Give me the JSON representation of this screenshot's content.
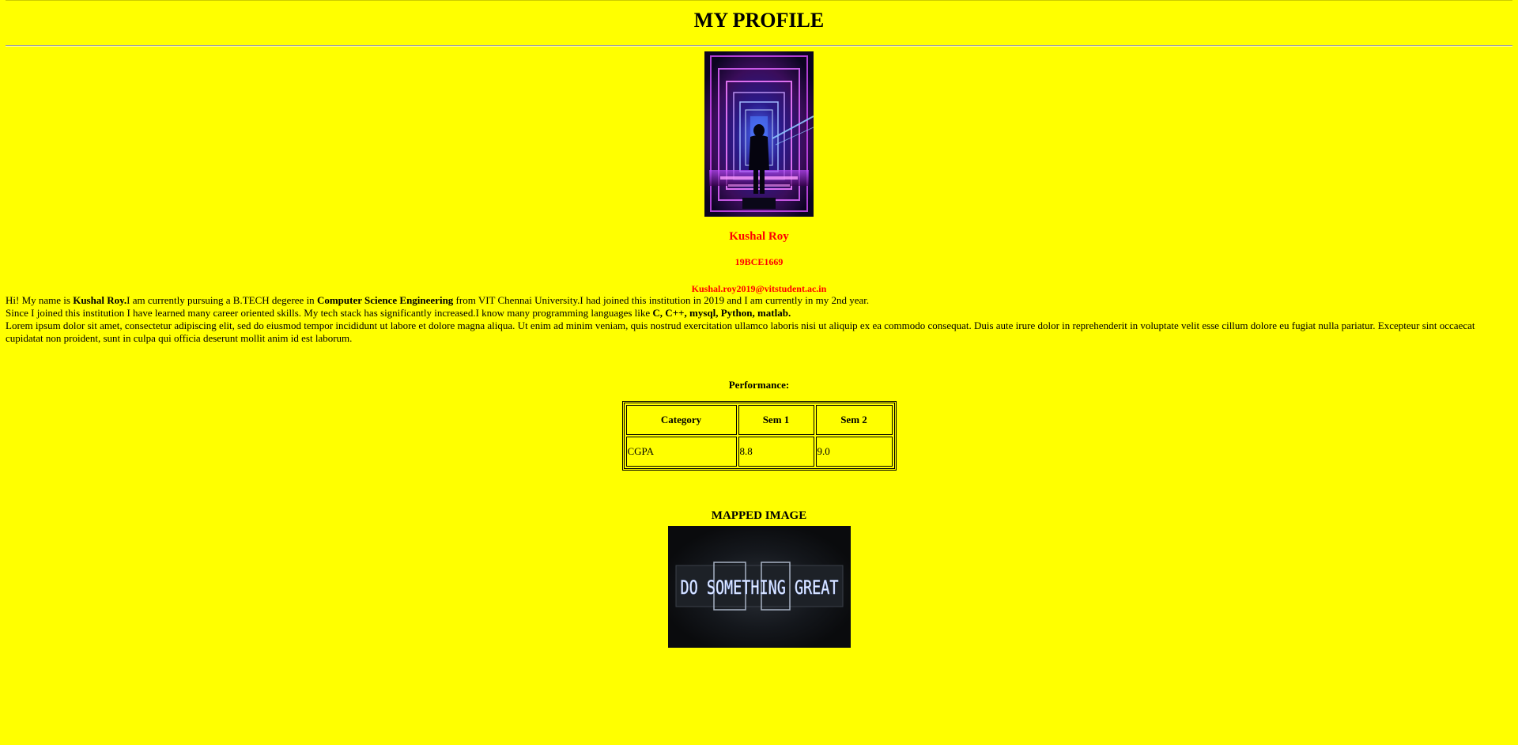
{
  "header": {
    "title": "MY PROFILE"
  },
  "profile": {
    "photo_icon": "person-in-neon-tunnel-photo",
    "name": "Kushal Roy",
    "reg_no": "19BCE1669",
    "email": "Kushal.roy2019@vitstudent.ac.in"
  },
  "about": {
    "p1": {
      "t1": "Hi! My name is ",
      "b1": "Kushal Roy.",
      "t2": "I am currently pursuing a B.TECH degeree in ",
      "b2": "Computer Science Engineering",
      "t3": " from VIT Chennai University.I had joined this institution in 2019 and I am currently in my 2nd year."
    },
    "p2": {
      "t1": "Since I joined this institution I have learned many career oriented skills. My tech stack has significantly increased.I know many programming languages like ",
      "b1": "C, C++, mysql, Python, matlab."
    },
    "p3": "Lorem ipsum dolor sit amet, consectetur adipiscing elit, sed do eiusmod tempor incididunt ut labore et dolore magna aliqua. Ut enim ad minim veniam, quis nostrud exercitation ullamco laboris nisi ut aliquip ex ea commodo consequat. Duis aute irure dolor in reprehenderit in voluptate velit esse cillum dolore eu fugiat nulla pariatur. Excepteur sint occaecat cupidatat non proident, sunt in culpa qui officia deserunt mollit anim id est laborum."
  },
  "performance": {
    "heading": "Performance:",
    "headers": [
      "Category",
      "Sem 1",
      "Sem 2"
    ],
    "rows": [
      [
        "CGPA",
        "8.8",
        "9.0"
      ]
    ]
  },
  "mapped": {
    "heading": "MAPPED IMAGE",
    "image_text": "DO SOMETHING GREAT"
  },
  "colors": {
    "background": "#ffff00",
    "accent_text": "#ff0000"
  }
}
